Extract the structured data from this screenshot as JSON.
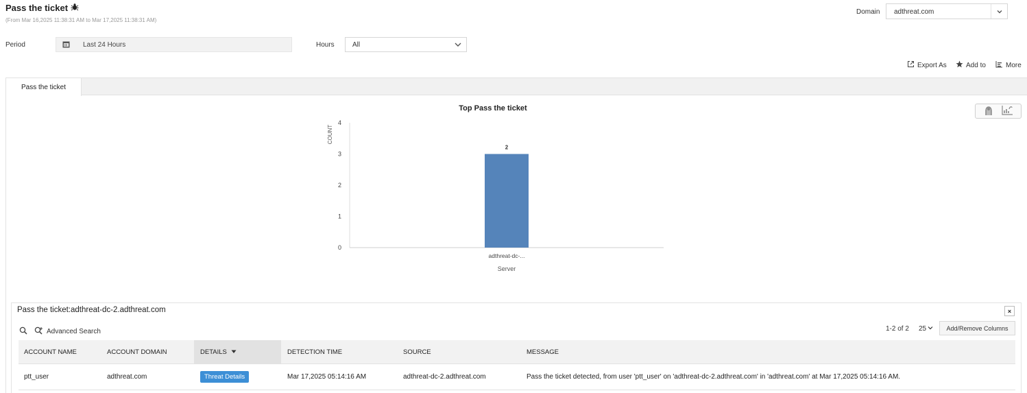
{
  "header": {
    "title": "Pass the ticket",
    "subtitle": "(From Mar 16,2025 11:38:31 AM to Mar 17,2025 11:38:31 AM)",
    "domain_label": "Domain",
    "domain_value": "adthreat.com"
  },
  "filters": {
    "period_label": "Period",
    "period_value": "Last 24 Hours",
    "hours_label": "Hours",
    "hours_value": "All"
  },
  "actions": {
    "export": "Export As",
    "add_to": "Add to",
    "more": "More"
  },
  "tabs": [
    {
      "label": "Pass the ticket",
      "active": true
    }
  ],
  "chart_data": {
    "type": "bar",
    "title": "Top Pass the ticket",
    "xlabel": "Server",
    "ylabel": "COUNT",
    "categories": [
      "adthreat-dc-..."
    ],
    "values": [
      3
    ],
    "data_labels": [
      "2"
    ],
    "ylim": [
      0,
      4
    ],
    "yticks": [
      "0",
      "1",
      "2",
      "3",
      "4"
    ],
    "bar_color": "#5584ba",
    "grid": false
  },
  "detail": {
    "title": "Pass the ticket:adthreat-dc-2.adthreat.com",
    "close": "×",
    "advanced_search": "Advanced Search",
    "pagination": "1-2 of 2",
    "page_size": "25",
    "add_remove_columns": "Add/Remove Columns",
    "columns": [
      "ACCOUNT NAME",
      "ACCOUNT DOMAIN",
      "DETAILS",
      "DETECTION TIME",
      "SOURCE",
      "MESSAGE"
    ],
    "rows": [
      {
        "account_name": "ptt_user",
        "account_domain": "adthreat.com",
        "details": "Threat Details",
        "detection_time": "Mar 17,2025 05:14:16 AM",
        "source": "adthreat-dc-2.adthreat.com",
        "message": "Pass the ticket detected, from user 'ptt_user' on 'adthreat-dc-2.adthreat.com' in 'adthreat.com' at Mar 17,2025 05:14:16 AM."
      }
    ]
  }
}
